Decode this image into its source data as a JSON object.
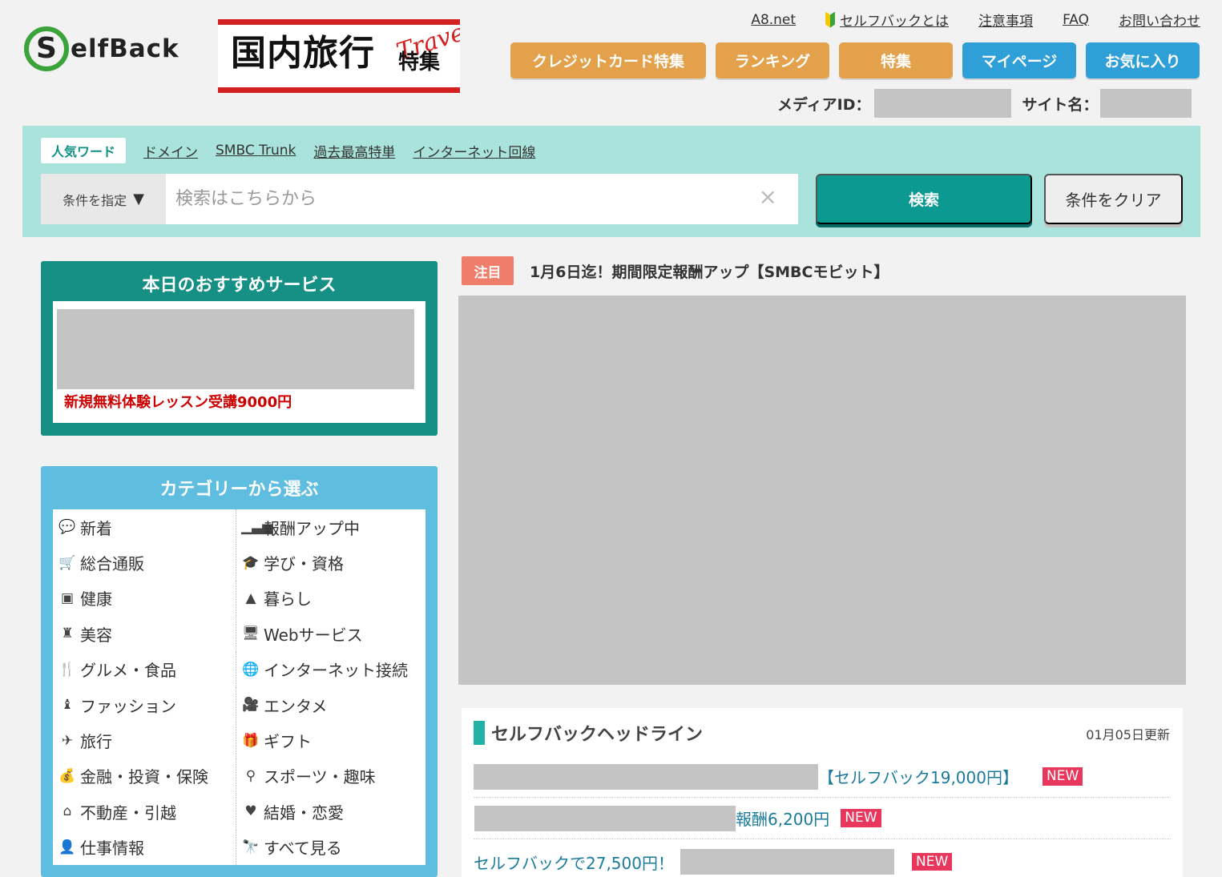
{
  "header": {
    "logo_text": "SelfBack",
    "logo_letter": "S",
    "logo_rest": "elfBack",
    "banner_main": "国内旅行",
    "banner_sub": "特集",
    "banner_travel": "Travel",
    "top_links": [
      "A8.net",
      "セルフバックとは",
      "注意事項",
      "FAQ",
      "お問い合わせ"
    ],
    "nav_buttons": [
      {
        "label": "クレジットカード特集",
        "color": "#e2a14a"
      },
      {
        "label": "ランキング",
        "color": "#e2a14a"
      },
      {
        "label": "特集",
        "color": "#e2a14a"
      },
      {
        "label": "マイページ",
        "color": "#2f9fd7"
      },
      {
        "label": "お気に入り",
        "color": "#2f9fd7"
      }
    ],
    "media_id_label": "メディアID：",
    "site_name_label": "サイト名："
  },
  "search": {
    "popular_label": "人気ワード",
    "popular_words": [
      "ドメイン",
      "SMBC Trunk",
      "過去最高特単",
      "インターネット回線"
    ],
    "condition_label": "条件を指定",
    "condition_arrow": "▼",
    "placeholder": "検索はこちらから",
    "clear_icon": "×",
    "search_button": "検索",
    "clear_button": "条件をクリア"
  },
  "recommend": {
    "title": "本日のおすすめサービス",
    "text": "新規無料体験レッスン受講9000円"
  },
  "categories": {
    "title": "カテゴリーから選ぶ",
    "left": [
      {
        "label": "新着",
        "icon": "speech-bubble-icon",
        "glyph": "💬"
      },
      {
        "label": "総合通販",
        "icon": "cart-icon",
        "glyph": "🛒"
      },
      {
        "label": "健康",
        "icon": "bottle-icon",
        "glyph": "▣"
      },
      {
        "label": "美容",
        "icon": "cosmetics-icon",
        "glyph": "♜"
      },
      {
        "label": "グルメ・食品",
        "icon": "fork-knife-icon",
        "glyph": "🍴"
      },
      {
        "label": "ファッション",
        "icon": "shirt-icon",
        "glyph": "♝"
      },
      {
        "label": "旅行",
        "icon": "airplane-icon",
        "glyph": "✈"
      },
      {
        "label": "金融・投資・保険",
        "icon": "money-bag-icon",
        "glyph": "💰"
      },
      {
        "label": "不動産・引越",
        "icon": "shop-icon",
        "glyph": "⌂"
      },
      {
        "label": "仕事情報",
        "icon": "person-icon",
        "glyph": "👤"
      }
    ],
    "right": [
      {
        "label": "報酬アップ中",
        "icon": "bar-chart-icon",
        "glyph": "▁▃▅"
      },
      {
        "label": "学び・資格",
        "icon": "graduation-cap-icon",
        "glyph": "🎓"
      },
      {
        "label": "暮らし",
        "icon": "lamp-icon",
        "glyph": "▲"
      },
      {
        "label": "Webサービス",
        "icon": "monitor-icon",
        "glyph": "🖥"
      },
      {
        "label": "インターネット接続",
        "icon": "globe-icon",
        "glyph": "🌐"
      },
      {
        "label": "エンタメ",
        "icon": "video-camera-icon",
        "glyph": "🎥"
      },
      {
        "label": "ギフト",
        "icon": "gift-icon",
        "glyph": "🎁"
      },
      {
        "label": "スポーツ・趣味",
        "icon": "dumbbell-icon",
        "glyph": "⚲"
      },
      {
        "label": "結婚・恋愛",
        "icon": "heart-icon",
        "glyph": "♥"
      },
      {
        "label": "すべて見る",
        "icon": "binoculars-icon",
        "glyph": "🔭"
      }
    ]
  },
  "notice": {
    "badge": "注目",
    "text": "1月6日迄！期間限定報酬アップ【SMBCモビット】"
  },
  "headline": {
    "title": "セルフバックヘッドライン",
    "date": "01月05日更新",
    "rows": [
      {
        "text": "【セルフバック19,000円】",
        "badge": "NEW"
      },
      {
        "text": "報酬6,200円",
        "badge": "NEW"
      },
      {
        "text": "セルフバックで27,500円！",
        "badge": "NEW"
      }
    ]
  },
  "colors": {
    "brand_teal": "#168f85",
    "search_bg": "#a9e3dc",
    "category_blue": "#5fbde0",
    "nav_orange": "#e2a14a",
    "nav_blue": "#2f9fd7",
    "notice_red": "#ef7d6b",
    "new_badge": "#e8365d"
  }
}
